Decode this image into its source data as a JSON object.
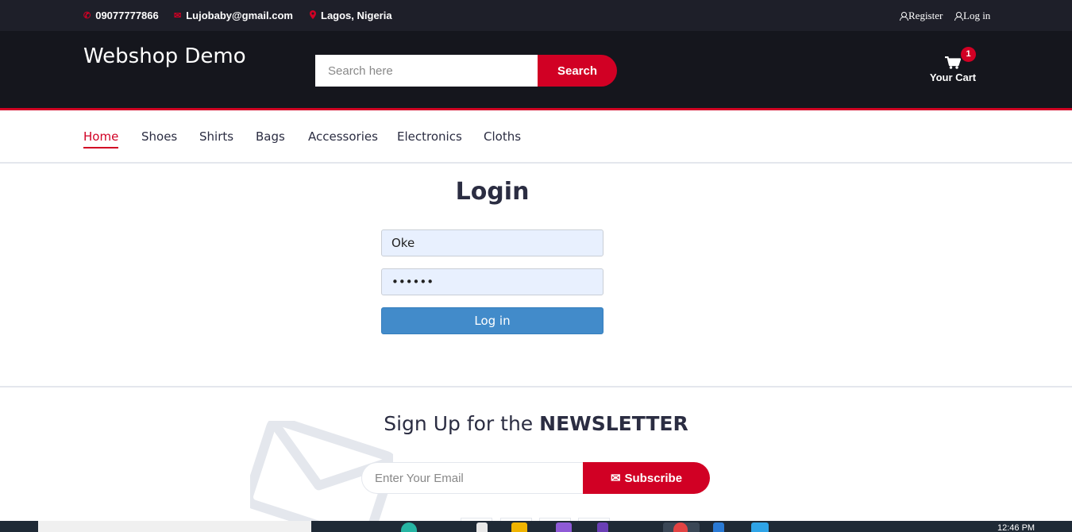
{
  "topbar": {
    "phone": "09077777866",
    "email": "Lujobaby@gmail.com",
    "location": "Lagos, Nigeria",
    "register": "Register",
    "login": "Log in"
  },
  "header": {
    "logo": "Webshop Demo",
    "search_placeholder": "Search here",
    "search_button": "Search",
    "cart_label": "Your Cart",
    "cart_qty": "1"
  },
  "nav": {
    "items": [
      "Home",
      "Shoes",
      "Shirts",
      "Bags",
      "Accessories",
      "Electronics",
      "Cloths"
    ],
    "active": "Home"
  },
  "login": {
    "title": "Login",
    "username_value": "Oke",
    "password_value": "••••••",
    "button": "Log in"
  },
  "newsletter": {
    "title_prefix": "Sign Up for the",
    "title_bold": "NEWSLETTER",
    "email_placeholder": "Enter Your Email",
    "subscribe": "Subscribe"
  },
  "taskbar": {
    "clock": "12:46 PM"
  },
  "colors": {
    "accent": "#d10024",
    "header_bg": "#15161d",
    "topbar_bg": "#1e1f29",
    "login_button": "#428bca"
  }
}
